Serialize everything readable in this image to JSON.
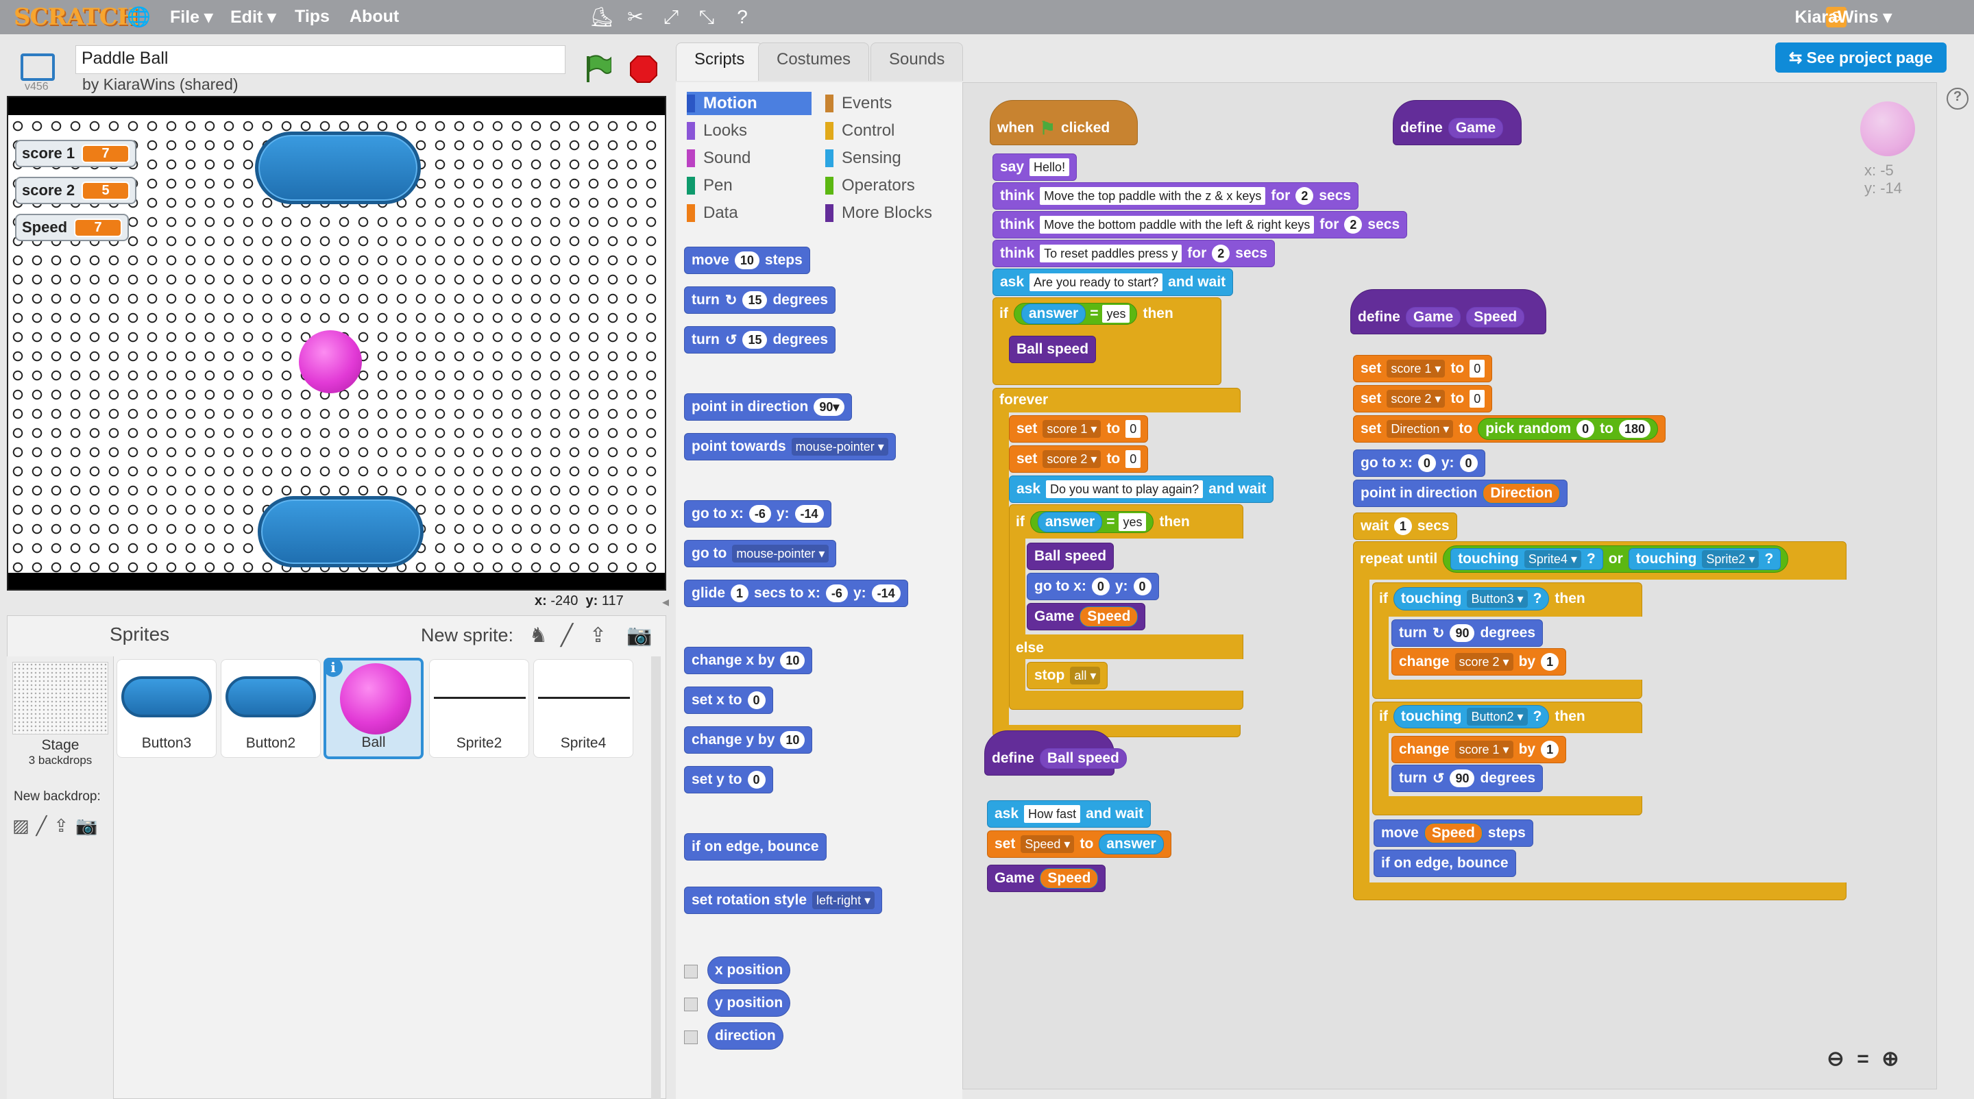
{
  "topbar": {
    "logo": "SCRATCH",
    "menu_file": "File ▾",
    "menu_edit": "Edit ▾",
    "menu_tips": "Tips",
    "menu_about": "About",
    "user": "KiaraWins ▾"
  },
  "project": {
    "title": "Paddle Ball",
    "byline": "by KiaraWins (shared)",
    "version": "v456"
  },
  "monitors": [
    {
      "label": "score 1",
      "value": "7"
    },
    {
      "label": "score 2",
      "value": "5"
    },
    {
      "label": "Speed",
      "value": "7"
    }
  ],
  "stage_coords": {
    "x_label": "x:",
    "x": "-240",
    "y_label": "y:",
    "y": "117"
  },
  "sprites": {
    "header": "Sprites",
    "new_sprite": "New sprite:",
    "stage_label": "Stage",
    "stage_backdrops": "3 backdrops",
    "new_backdrop": "New backdrop:",
    "list": [
      "Button3",
      "Button2",
      "Ball",
      "Sprite2",
      "Sprite4"
    ]
  },
  "tabs": [
    "Scripts",
    "Costumes",
    "Sounds"
  ],
  "categories": {
    "motion": "Motion",
    "looks": "Looks",
    "sound": "Sound",
    "pen": "Pen",
    "data": "Data",
    "events": "Events",
    "control": "Control",
    "sensing": "Sensing",
    "operators": "Operators",
    "more": "More Blocks"
  },
  "palette": {
    "move": "move",
    "steps": "steps",
    "move_val": "10",
    "turn": "turn",
    "degrees": "degrees",
    "turn_val": "15",
    "point_in_direction": "point in direction",
    "dir_val": "90▾",
    "point_towards": "point towards",
    "mouse_pointer": "mouse-pointer ▾",
    "go_to": "go to x:",
    "gx": "-6",
    "y": "y:",
    "gy": "-14",
    "go_to2": "go to",
    "glide": "glide",
    "secs_to_x": "secs to x:",
    "glide_val": "1",
    "change_x_by": "change x by",
    "cx_val": "10",
    "set_x_to": "set x to",
    "sx_val": "0",
    "change_y_by": "change y by",
    "cy_val": "10",
    "set_y_to": "set y to",
    "sy_val": "0",
    "if_on_edge": "if on edge, bounce",
    "set_rot": "set rotation style",
    "rot_val": "left-right ▾",
    "x_position": "x position",
    "y_position": "y position",
    "direction": "direction"
  },
  "see_project": "See project page",
  "thumb_coords": {
    "x": "x: -5",
    "y": "y: -14"
  },
  "scripts": {
    "when": "when",
    "clicked": "clicked",
    "say": "say",
    "hello": "Hello!",
    "think": "think",
    "for": "for",
    "secs": "secs",
    "think1": "Move the top paddle with the z & x keys",
    "think2": "Move the bottom paddle with the left & right keys",
    "think3": "To reset paddles press y",
    "two": "2",
    "ask": "ask",
    "and_wait": "and wait",
    "ask1": "Are you ready to start?",
    "if": "if",
    "then": "then",
    "answer": "answer",
    "eq": "=",
    "yes": "yes",
    "ball_speed": "Ball speed",
    "forever": "forever",
    "set": "set",
    "to": "to",
    "score1": "score 1 ▾",
    "score2": "score 2 ▾",
    "zero": "0",
    "ask2": "Do you want to play again?",
    "go_to_x": "go to x:",
    "y_": "y:",
    "game": "Game",
    "speed": "Speed",
    "else": "else",
    "stop": "stop",
    "all": "all ▾",
    "define": "define",
    "how_fast": "How fast",
    "speed_dd": "Speed ▾",
    "direction_dd": "Direction ▾",
    "pick_random": "pick random",
    "r0": "0",
    "r180": "180",
    "point_in_direction": "point in direction",
    "direction": "Direction",
    "wait": "wait",
    "one": "1",
    "repeat_until": "repeat until",
    "touching": "touching",
    "sprite4": "Sprite4 ▾",
    "sprite2": "Sprite2 ▾",
    "q": "?",
    "or": "or",
    "button3": "Button3 ▾",
    "button2": "Button2 ▾",
    "turn": "turn",
    "degrees": "degrees",
    "ninety": "90",
    "change": "change",
    "by": "by",
    "move": "move",
    "steps": "steps",
    "if_on_edge": "if on edge, bounce"
  }
}
